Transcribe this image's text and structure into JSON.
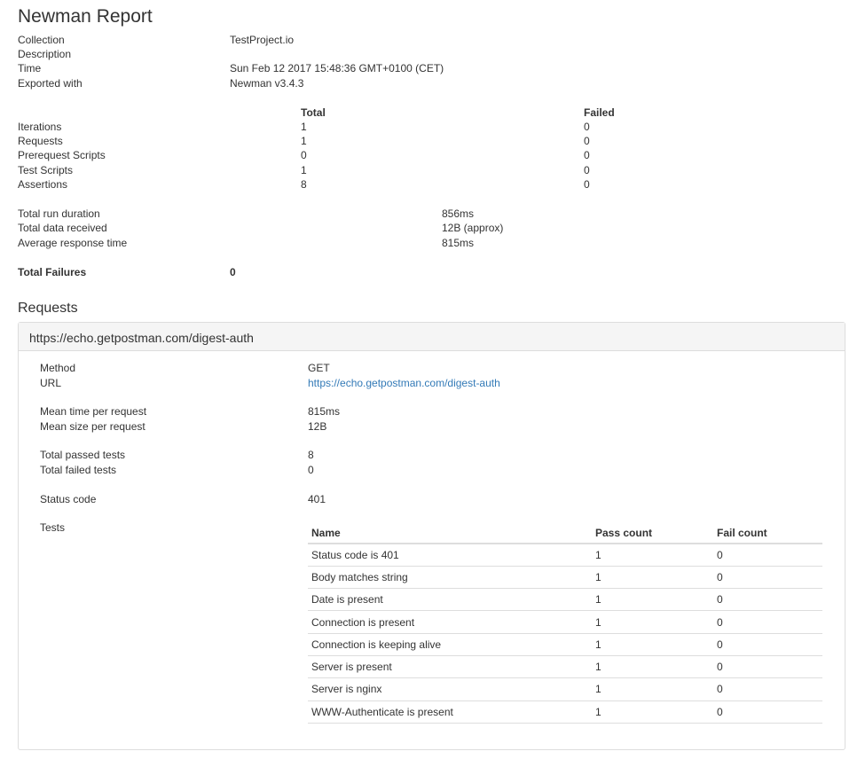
{
  "report": {
    "title": "Newman Report",
    "info": [
      {
        "label": "Collection",
        "value": "TestProject.io"
      },
      {
        "label": "Description",
        "value": ""
      },
      {
        "label": "Time",
        "value": "Sun Feb 12 2017 15:48:36 GMT+0100 (CET)"
      },
      {
        "label": "Exported with",
        "value": "Newman v3.4.3"
      }
    ]
  },
  "summary": {
    "total_header": "Total",
    "failed_header": "Failed",
    "rows": [
      {
        "label": "Iterations",
        "total": "1",
        "failed": "0"
      },
      {
        "label": "Requests",
        "total": "1",
        "failed": "0"
      },
      {
        "label": "Prerequest Scripts",
        "total": "0",
        "failed": "0"
      },
      {
        "label": "Test Scripts",
        "total": "1",
        "failed": "0"
      },
      {
        "label": "Assertions",
        "total": "8",
        "failed": "0"
      }
    ]
  },
  "run": [
    {
      "label": "Total run duration",
      "value": "856ms"
    },
    {
      "label": "Total data received",
      "value": "12B (approx)"
    },
    {
      "label": "Average response time",
      "value": "815ms"
    }
  ],
  "failures": {
    "label": "Total Failures",
    "value": "0"
  },
  "requests_heading": "Requests",
  "request": {
    "heading": "https://echo.getpostman.com/digest-auth",
    "method_label": "Method",
    "method": "GET",
    "url_label": "URL",
    "url": "https://echo.getpostman.com/digest-auth",
    "mean_time_label": "Mean time per request",
    "mean_time": "815ms",
    "mean_size_label": "Mean size per request",
    "mean_size": "12B",
    "passed_label": "Total passed tests",
    "passed": "8",
    "failed_label": "Total failed tests",
    "failed": "0",
    "status_label": "Status code",
    "status": "401",
    "tests_label": "Tests",
    "tests_headers": {
      "name": "Name",
      "pass": "Pass count",
      "fail": "Fail count"
    },
    "tests": [
      {
        "name": "Status code is 401",
        "pass": "1",
        "fail": "0"
      },
      {
        "name": "Body matches string",
        "pass": "1",
        "fail": "0"
      },
      {
        "name": "Date is present",
        "pass": "1",
        "fail": "0"
      },
      {
        "name": "Connection is present",
        "pass": "1",
        "fail": "0"
      },
      {
        "name": "Connection is keeping alive",
        "pass": "1",
        "fail": "0"
      },
      {
        "name": "Server is present",
        "pass": "1",
        "fail": "0"
      },
      {
        "name": "Server is nginx",
        "pass": "1",
        "fail": "0"
      },
      {
        "name": "WWW-Authenticate is present",
        "pass": "1",
        "fail": "0"
      }
    ]
  }
}
